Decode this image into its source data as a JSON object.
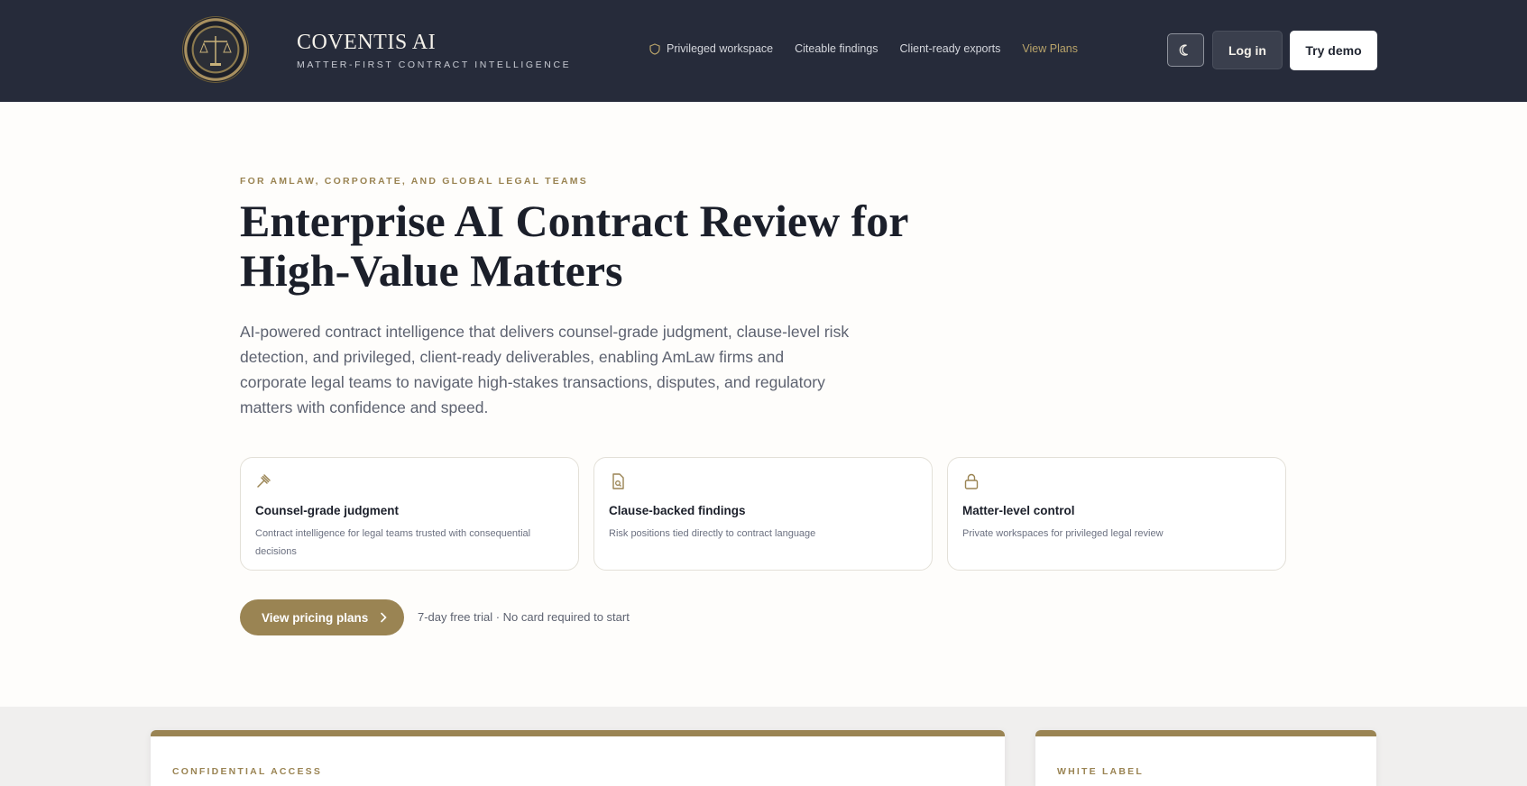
{
  "header": {
    "brand_name": "COVENTIS AI",
    "brand_tagline": "MATTER-FIRST CONTRACT INTELLIGENCE",
    "seal_text": "COVENTIS AI · CONTRACT INTELLIGENCE",
    "nav": [
      {
        "label": "Privileged workspace",
        "icon": "shield-icon"
      },
      {
        "label": "Citeable findings"
      },
      {
        "label": "Client-ready exports"
      },
      {
        "label": "View Plans",
        "accent": "#b8a36a"
      }
    ],
    "theme_toggle_icon": "moon-icon",
    "login_label": "Log in",
    "demo_label": "Try demo"
  },
  "hero": {
    "eyebrow": "FOR AMLAW, CORPORATE, AND GLOBAL LEGAL TEAMS",
    "title_line1": "Enterprise AI Contract Review for",
    "title_line2": "High-Value Matters",
    "description": "AI-powered contract intelligence that delivers counsel-grade judgment, clause-level risk detection, and privileged, client-ready deliverables, enabling AmLaw firms and corporate legal teams to navigate high-stakes transactions, disputes, and regulatory matters with confidence and speed."
  },
  "features": [
    {
      "icon": "gavel-icon",
      "title": "Counsel-grade judgment",
      "desc": "Contract intelligence for legal teams trusted with consequential decisions"
    },
    {
      "icon": "document-search-icon",
      "title": "Clause-backed findings",
      "desc": "Risk positions tied directly to contract language"
    },
    {
      "icon": "lock-icon",
      "title": "Matter-level control",
      "desc": "Private workspaces for privileged legal review"
    }
  ],
  "cta": {
    "label": "View pricing plans",
    "note": "7-day free trial · No card required to start"
  },
  "panels": {
    "left_tag": "CONFIDENTIAL ACCESS",
    "right_tag": "WHITE LABEL"
  },
  "colors": {
    "header_bg": "#262b3a",
    "accent_gold": "#9a8453",
    "page_bg": "#fefdfb"
  }
}
